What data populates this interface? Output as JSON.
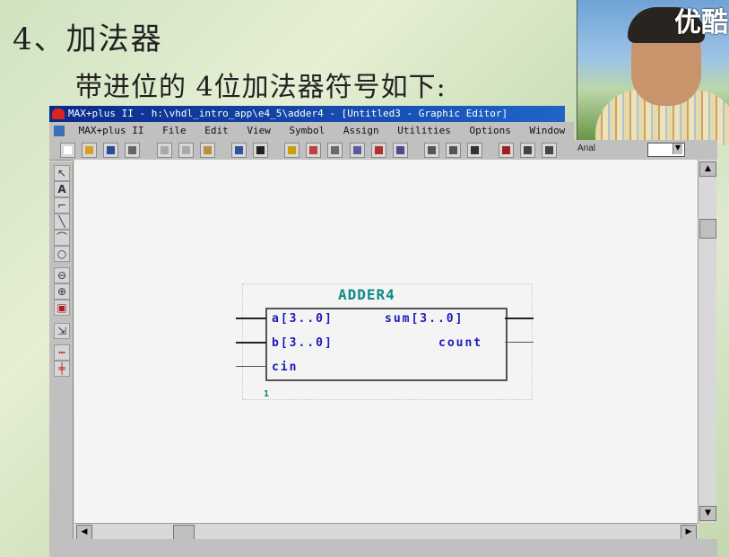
{
  "slide": {
    "heading": "4、加法器",
    "subheading": "带进位的 4位加法器符号如下:"
  },
  "video_overlay": {
    "logo_text": "优酷"
  },
  "window": {
    "title": "MAX+plus II - h:\\vhdl_intro_app\\e4_5\\adder4 - [Untitled3 - Graphic Editor]",
    "menu": [
      "MAX+plus II",
      "File",
      "Edit",
      "View",
      "Symbol",
      "Assign",
      "Utilities",
      "Options",
      "Window"
    ],
    "font_label": "Arial"
  },
  "toolbar_icons": [
    "new-file-icon",
    "open-folder-icon",
    "save-icon",
    "print-icon",
    "cut-icon",
    "copy-icon",
    "paste-icon",
    "undo-icon",
    "help-pointer-icon",
    "hierarchy-up-icon",
    "hierarchy-down-icon",
    "project-save-icon",
    "compile-icon",
    "simulate-icon",
    "timing-icon",
    "floorplan-icon",
    "rotate-icon",
    "flip-icon",
    "text-icon",
    "programmer-icon",
    "waveform-icon",
    "report-icon",
    "pin-icon"
  ],
  "palette_icons": [
    "select-arrow-icon",
    "text-tool-icon",
    "orthogonal-line-icon",
    "diagonal-line-icon",
    "arc-icon",
    "circle-icon",
    "zoom-out-icon",
    "zoom-in-icon",
    "fit-window-icon",
    "rubberband-icon",
    "connect-dot-icon",
    "bus-connect-icon"
  ],
  "symbol": {
    "name": "ADDER4",
    "inputs": [
      "a[3..0]",
      "b[3..0]",
      "cin"
    ],
    "outputs": [
      "sum[3..0]",
      "count"
    ],
    "instance_number": "1"
  }
}
